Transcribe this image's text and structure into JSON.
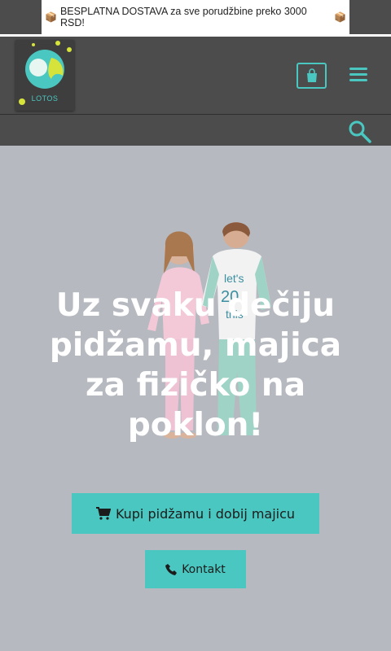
{
  "promo": {
    "text": "BESPLATNA DOSTAVA za sve porudžbine preko 3000 RSD!",
    "icon_left": "package-icon",
    "icon_right": "package-icon"
  },
  "header": {
    "logo_text": "LOTOS",
    "cart_icon": "shopping-bag-icon",
    "menu_icon": "hamburger-menu-icon",
    "search_icon": "search-icon"
  },
  "hero": {
    "headline": "Uz svaku dečiju pidžamu, majica za fizičko na poklon!",
    "image": "kids-in-pajamas-photo",
    "buy_button": {
      "label": "Kupi pidžamu i dobij majicu",
      "icon": "shopping-cart-icon"
    },
    "contact_button": {
      "label": "Kontakt",
      "icon": "phone-icon"
    }
  },
  "colors": {
    "accent": "#4ac7c0",
    "header_bg": "#4c4c4c",
    "hero_bg": "#b6b9bf",
    "logo_yellow": "#d6e33a"
  }
}
